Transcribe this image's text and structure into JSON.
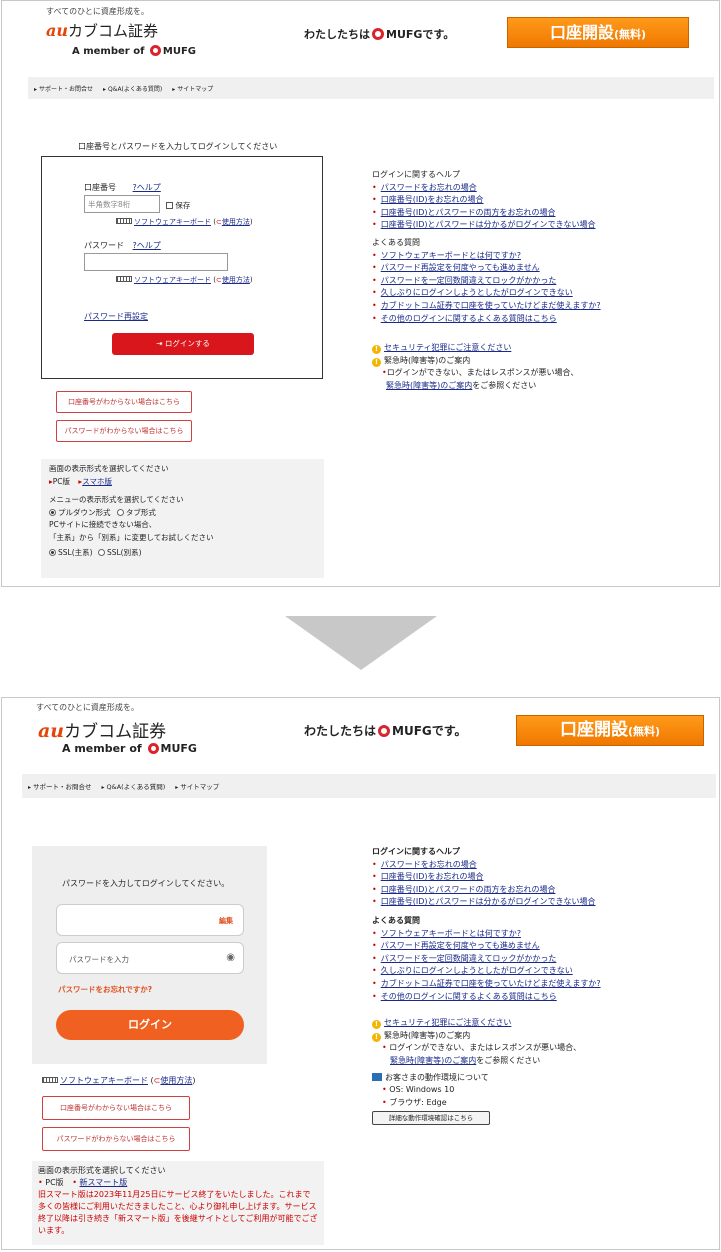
{
  "before": {
    "header": {
      "tagline": "すべてのひとに資産形成を。",
      "logo_au": "au",
      "logo_name": "カブコム証券",
      "member": "A member of",
      "member_brand": "MUFG",
      "mufg_prefix": "わたしたちは",
      "mufg_brand": "MUFG",
      "mufg_suffix": "です。",
      "open_account": "口座開設",
      "open_account_free": "(無料)"
    },
    "nav": [
      "サポート・お問合せ",
      "Q&A(よくある質問)",
      "サイトマップ"
    ],
    "login": {
      "instruction": "口座番号とパスワードを入力してログインしてください",
      "account_label": "口座番号",
      "help": "?ヘルプ",
      "account_placeholder": "半角数字8桁",
      "save_label": "保存",
      "software_keyboard": "ソフトウェアキーボード",
      "howto": "使用方法",
      "password_label": "パスワード",
      "password_reset": "パスワード再設定",
      "login_button": "ログインする"
    },
    "help_links": {
      "login_help_heading": "ログインに関するヘルプ",
      "login_help_items": [
        "パスワードをお忘れの場合",
        "口座番号(ID)をお忘れの場合",
        "口座番号(ID)とパスワードの両方をお忘れの場合",
        "口座番号(ID)とパスワードは分かるがログインできない場合"
      ],
      "faq_heading": "よくある質問",
      "faq_items": [
        "ソフトウェアキーボードとは何ですか?",
        "パスワード再設定を何度やっても進めません",
        "パスワードを一定回数間違えてロックがかかった",
        "久しぶりにログインしようとしたがログインできない",
        "カブドットコム証券で口座を使っていたけどまだ使えますか?",
        "その他のログインに関するよくある質問はこちら"
      ],
      "security": "セキュリティ犯罪にご注意ください",
      "emergency": "緊急時(障害等)のご案内",
      "emergency_note": "ログインができない、またはレスポンスが悪い場合、",
      "emergency_link": "緊急時(障害等)のご案内",
      "emergency_tail": "をご参照ください"
    },
    "help_buttons": {
      "account_unknown": "口座番号がわからない場合はこちら",
      "password_unknown": "パスワードがわからない場合はこちら"
    },
    "display": {
      "screen_heading": "画面の表示形式を選択してください",
      "pc": "PC版",
      "smartphone": "スマホ版",
      "menu_heading": "メニューの表示形式を選択してください",
      "pulldown": "プルダウン形式",
      "tab": "タブ形式",
      "connect_note1": "PCサイトに接続できない場合、",
      "connect_note2": "「主系」から「別系」に変更してお試しください",
      "ssl_main": "SSL(主系)",
      "ssl_sub": "SSL(別系)"
    }
  },
  "after": {
    "header": {
      "tagline": "すべてのひとに資産形成を。",
      "logo_au": "au",
      "logo_name": "カブコム証券",
      "member": "A member of",
      "member_brand": "MUFG",
      "mufg_prefix": "わたしたちは",
      "mufg_brand": "MUFG",
      "mufg_suffix": "です。",
      "open_account": "口座開設",
      "open_account_free": "(無料)"
    },
    "nav": [
      "サポート・お問合せ",
      "Q&A(よくある質問)",
      "サイトマップ"
    ],
    "login": {
      "instruction": "パスワードを入力してログインしてください。",
      "edit": "編集",
      "password_placeholder": "パスワードを入力",
      "forgot": "パスワードをお忘れですか?",
      "login_button": "ログイン",
      "software_keyboard": "ソフトウェアキーボード",
      "howto": "使用方法"
    },
    "help_links": {
      "login_help_heading": "ログインに関するヘルプ",
      "login_help_items": [
        "パスワードをお忘れの場合",
        "口座番号(ID)をお忘れの場合",
        "口座番号(ID)とパスワードの両方をお忘れの場合",
        "口座番号(ID)とパスワードは分かるがログインできない場合"
      ],
      "faq_heading": "よくある質問",
      "faq_items": [
        "ソフトウェアキーボードとは何ですか?",
        "パスワード再設定を何度やっても進めません",
        "パスワードを一定回数間違えてロックがかかった",
        "久しぶりにログインしようとしたがログインできない",
        "カブドットコム証券で口座を使っていたけどまだ使えますか?",
        "その他のログインに関するよくある質問はこちら"
      ],
      "security": "セキュリティ犯罪にご注意ください",
      "emergency": "緊急時(障害等)のご案内",
      "emergency_note": "ログインができない、またはレスポンスが悪い場合、",
      "emergency_link": "緊急時(障害等)のご案内",
      "emergency_tail": "をご参照ください",
      "env_heading": "お客さまの動作環境について",
      "env_os": "OS: Windows 10",
      "env_browser": "ブラウザ: Edge",
      "env_button": "詳細な動作環境確認はこちら"
    },
    "help_buttons": {
      "account_unknown": "口座番号がわからない場合はこちら",
      "password_unknown": "パスワードがわからない場合はこちら"
    },
    "display": {
      "screen_heading": "画面の表示形式を選択してください",
      "pc": "PC版",
      "smartphone": "新スマート版",
      "notice": "旧スマート版は2023年11月25日にサービス終了をいたしました。これまで多くの皆様にご利用いただきましたこと、心より御礼申し上げます。サービス終了以降は引き続き「新スマート版」を後継サイトとしてご利用が可能でございます。"
    }
  },
  "colors": {
    "accent_red": "#d8161c",
    "accent_orange": "#f06020",
    "link": "#1a2a8a"
  }
}
